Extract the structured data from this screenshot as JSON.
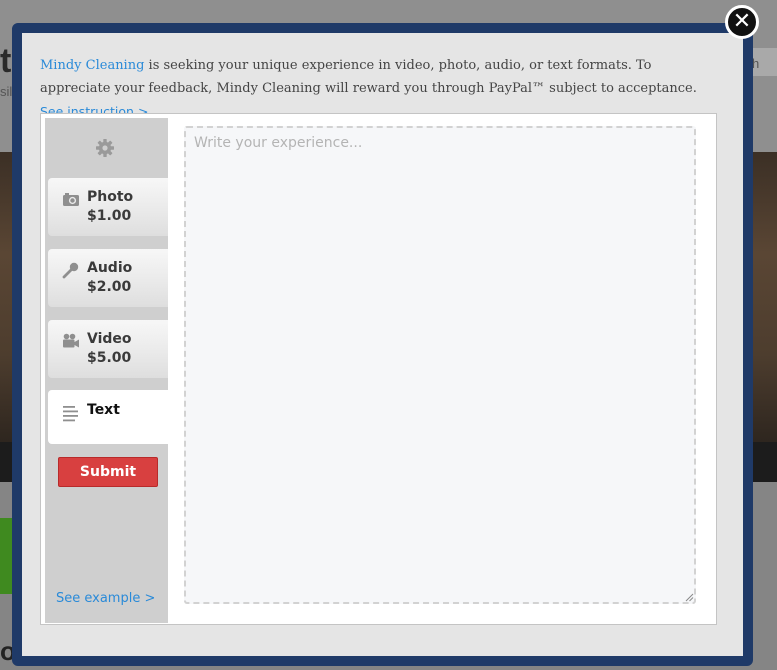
{
  "background_page": {
    "title_fragment": "t",
    "subtitle_fragment": "sily",
    "search_fragment": "h",
    "bottom_fragment": "o"
  },
  "modal": {
    "close_label": "✕",
    "intro": {
      "brand_link": "Mindy Cleaning",
      "text": " is seeking your unique experience in video, photo, audio, or text formats. To appreciate your feedback, Mindy Cleaning will reward you through PayPal™ subject to acceptance. ",
      "instruction_link": "See instruction >"
    },
    "sidebar": {
      "settings_icon": "gear-icon",
      "tabs": [
        {
          "label": "Photo",
          "price": "$1.00",
          "icon": "camera-icon"
        },
        {
          "label": "Audio",
          "price": "$2.00",
          "icon": "microphone-icon"
        },
        {
          "label": "Video",
          "price": "$5.00",
          "icon": "video-camera-icon"
        },
        {
          "label": "Text",
          "price": "",
          "icon": "text-lines-icon",
          "active": true
        }
      ],
      "submit_label": "Submit",
      "see_example_label": "See example >"
    },
    "editor": {
      "placeholder": "Write your experience...",
      "value": ""
    }
  },
  "colors": {
    "modal_border": "#1f3a68",
    "link": "#2a8ad8",
    "submit": "#d84040"
  }
}
